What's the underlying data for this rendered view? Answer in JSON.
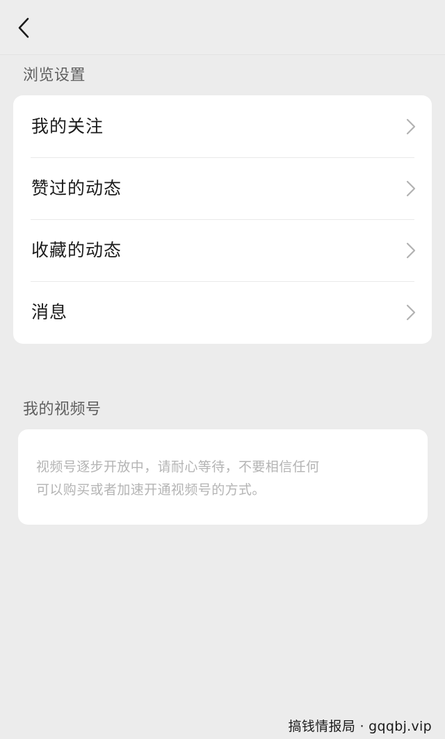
{
  "nav": {
    "back_icon": "chevron-left-icon"
  },
  "browse": {
    "section_title": "浏览设置",
    "items": [
      {
        "label": "我的关注",
        "icon": "chevron-right-icon"
      },
      {
        "label": "赞过的动态",
        "icon": "chevron-right-icon"
      },
      {
        "label": "收藏的动态",
        "icon": "chevron-right-icon"
      },
      {
        "label": "消息",
        "icon": "chevron-right-icon"
      }
    ]
  },
  "channels": {
    "section_title": "我的视频号",
    "notice_line1": "视频号逐步开放中，请耐心等待，不要相信任何",
    "notice_line2": "可以购买或者加速开通视频号的方式。"
  },
  "watermark": "搞钱情报局 · gqqbj.vip",
  "colors": {
    "background": "#ececec",
    "card": "#ffffff",
    "primary_text": "#1c1c1c",
    "secondary_text": "#5f5f5f",
    "muted_text": "#b4b4b4",
    "chevron": "#b2b2b2"
  }
}
